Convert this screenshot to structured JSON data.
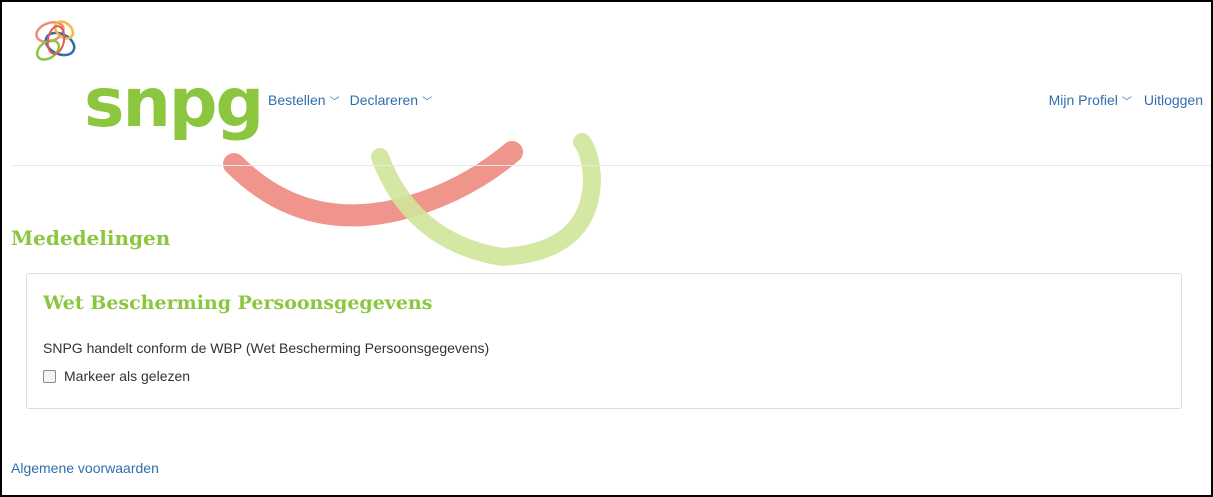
{
  "brand": {
    "logo_text": "snpg",
    "colors": {
      "green": "#8cc63f",
      "link_blue": "#2f6ead",
      "deco_red": "#ee8a7e",
      "deco_green": "#cfe59a"
    }
  },
  "nav": {
    "left": [
      {
        "label": "Bestellen",
        "icon": "chevron-down-icon"
      },
      {
        "label": "Declareren",
        "icon": "chevron-down-icon"
      }
    ],
    "right": [
      {
        "label": "Mijn Profiel",
        "icon": "chevron-down-icon"
      },
      {
        "label": "Uitloggen"
      }
    ]
  },
  "main": {
    "title": "Mededelingen",
    "notice": {
      "title": "Wet Bescherming Persoonsgegevens",
      "body": "SNPG handelt conform de WBP (Wet Bescherming Persoonsgegevens)",
      "checkbox_label": "Markeer als gelezen",
      "checked": false
    }
  },
  "footer": {
    "link": "Algemene voorwaarden"
  }
}
